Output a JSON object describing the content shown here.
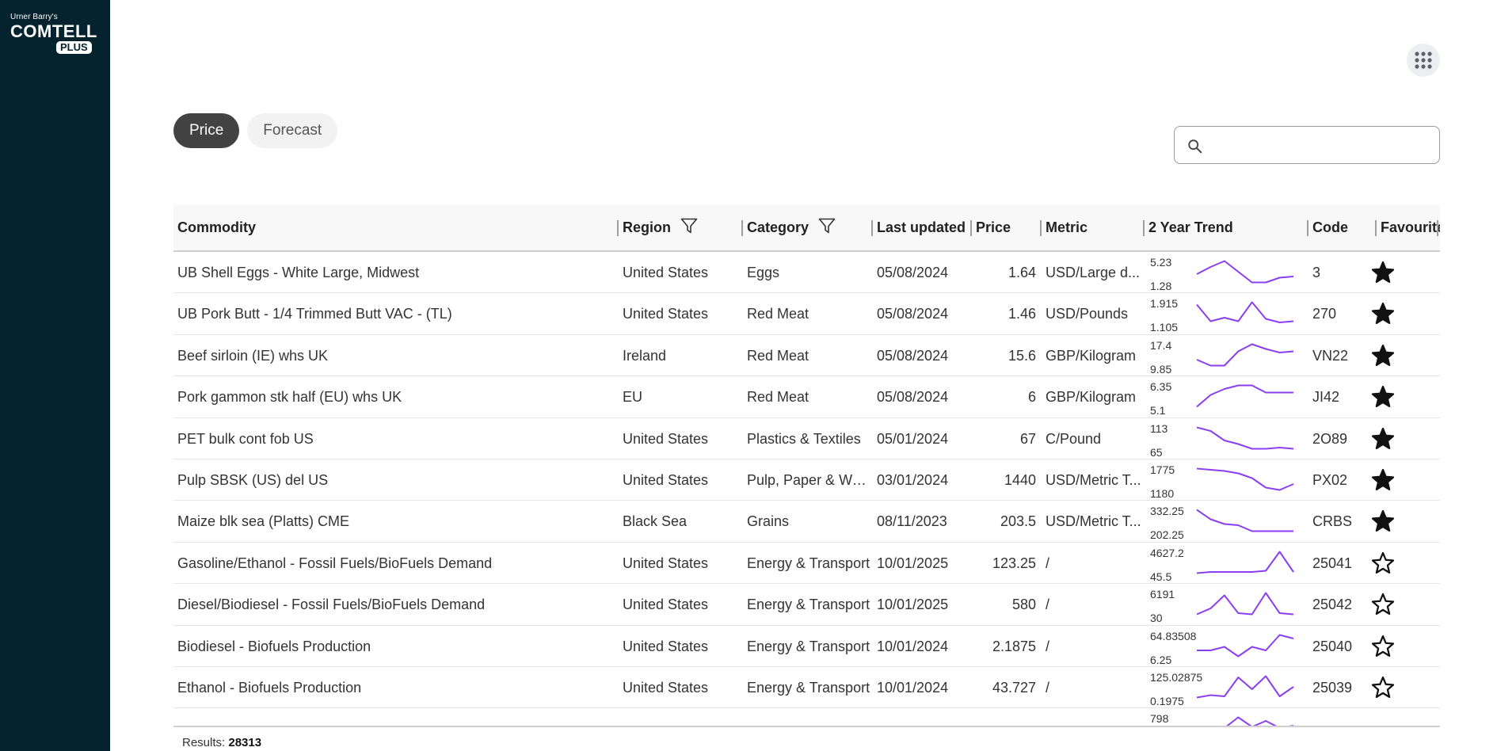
{
  "logo": {
    "top": "Urner Barry's",
    "main": "COMTELL",
    "badge": "PLUS"
  },
  "apps_icon": "apps-grid-icon",
  "tabs": [
    {
      "label": "Price",
      "active": true
    },
    {
      "label": "Forecast",
      "active": false
    }
  ],
  "search": {
    "placeholder": "",
    "value": "",
    "icon": "search-icon"
  },
  "table": {
    "columns": [
      "Commodity",
      "Region",
      "Category",
      "Last updated",
      "Price",
      "Metric",
      "2 Year Trend",
      "Code",
      "Favourite"
    ],
    "filter_columns": [
      "Region",
      "Category"
    ],
    "rows": [
      {
        "commodity": "UB Shell Eggs - White Large, Midwest",
        "region": "United States",
        "category": "Eggs",
        "last_updated": "05/08/2024",
        "price": "1.64",
        "metric": "USD/Large d...",
        "trend_max": "5.23",
        "trend_min": "1.28",
        "trend": [
          0.4,
          0.7,
          0.95,
          0.5,
          0.05,
          0.05,
          0.25,
          0.3
        ],
        "code": "3",
        "favourite": true
      },
      {
        "commodity": "UB Pork Butt - 1/4 Trimmed Butt VAC - (TL)",
        "region": "United States",
        "category": "Red Meat",
        "last_updated": "05/08/2024",
        "price": "1.46",
        "metric": "USD/Pounds",
        "trend_max": "1.915",
        "trend_min": "1.105",
        "trend": [
          0.85,
          0.15,
          0.3,
          0.15,
          0.95,
          0.25,
          0.1,
          0.15
        ],
        "code": "270",
        "favourite": true
      },
      {
        "commodity": "Beef sirloin (IE) whs UK",
        "region": "Ireland",
        "category": "Red Meat",
        "last_updated": "05/08/2024",
        "price": "15.6",
        "metric": "GBP/Kilogram",
        "trend_max": "17.4",
        "trend_min": "9.85",
        "trend": [
          0.3,
          0.05,
          0.05,
          0.65,
          0.95,
          0.75,
          0.6,
          0.65
        ],
        "code": "VN22",
        "favourite": true
      },
      {
        "commodity": "Pork gammon stk half (EU) whs UK",
        "region": "EU",
        "category": "Red Meat",
        "last_updated": "05/08/2024",
        "price": "6",
        "metric": "GBP/Kilogram",
        "trend_max": "6.35",
        "trend_min": "5.1",
        "trend": [
          0.05,
          0.55,
          0.8,
          0.95,
          0.95,
          0.65,
          0.65,
          0.65
        ],
        "code": "JI42",
        "favourite": true
      },
      {
        "commodity": "PET bulk cont fob US",
        "region": "United States",
        "category": "Plastics & Textiles",
        "last_updated": "05/01/2024",
        "price": "67",
        "metric": "C/Pound",
        "trend_max": "113",
        "trend_min": "65",
        "trend": [
          0.95,
          0.8,
          0.4,
          0.25,
          0.05,
          0.05,
          0.1,
          0.05
        ],
        "code": "2O89",
        "favourite": true
      },
      {
        "commodity": "Pulp SBSK (US) del US",
        "region": "United States",
        "category": "Pulp, Paper & Wo...",
        "last_updated": "03/01/2024",
        "price": "1440",
        "metric": "USD/Metric T...",
        "trend_max": "1775",
        "trend_min": "1180",
        "trend": [
          0.95,
          0.9,
          0.85,
          0.75,
          0.55,
          0.15,
          0.05,
          0.3
        ],
        "code": "PX02",
        "favourite": true
      },
      {
        "commodity": "Maize blk sea (Platts) CME",
        "region": "Black Sea",
        "category": "Grains",
        "last_updated": "08/11/2023",
        "price": "203.5",
        "metric": "USD/Metric T...",
        "trend_max": "332.25",
        "trend_min": "202.25",
        "trend": [
          0.95,
          0.55,
          0.35,
          0.3,
          0.05,
          0.05,
          0.05,
          0.05
        ],
        "code": "CRBS",
        "favourite": true
      },
      {
        "commodity": "Gasoline/Ethanol - Fossil Fuels/BioFuels Demand",
        "region": "United States",
        "category": "Energy & Transport",
        "last_updated": "10/01/2025",
        "price": "123.25",
        "metric": "/",
        "trend_max": "4627.2",
        "trend_min": "45.5",
        "trend": [
          0.05,
          0.1,
          0.1,
          0.1,
          0.1,
          0.15,
          0.95,
          0.1
        ],
        "code": "25041",
        "favourite": false
      },
      {
        "commodity": "Diesel/Biodiesel - Fossil Fuels/BioFuels Demand",
        "region": "United States",
        "category": "Energy & Transport",
        "last_updated": "10/01/2025",
        "price": "580",
        "metric": "/",
        "trend_max": "6191",
        "trend_min": "30",
        "trend": [
          0.05,
          0.3,
          0.85,
          0.1,
          0.05,
          0.95,
          0.1,
          0.05
        ],
        "code": "25042",
        "favourite": false
      },
      {
        "commodity": "Biodiesel - Biofuels Production",
        "region": "United States",
        "category": "Energy & Transport",
        "last_updated": "10/01/2024",
        "price": "2.1875",
        "metric": "/",
        "trend_max": "64.83508",
        "trend_min": "6.25",
        "trend": [
          0.3,
          0.3,
          0.45,
          0.05,
          0.45,
          0.3,
          0.95,
          0.8
        ],
        "code": "25040",
        "favourite": false
      },
      {
        "commodity": "Ethanol - Biofuels Production",
        "region": "United States",
        "category": "Energy & Transport",
        "last_updated": "10/01/2024",
        "price": "43.727",
        "metric": "/",
        "trend_max": "125.02875",
        "trend_min": "0.1975",
        "trend": [
          0.05,
          0.15,
          0.1,
          0.9,
          0.4,
          0.95,
          0.1,
          0.5
        ],
        "code": "25039",
        "favourite": false
      },
      {
        "commodity": "",
        "region": "",
        "category": "",
        "last_updated": "",
        "price": "",
        "metric": "",
        "trend_max": "798",
        "trend_min": "",
        "trend": [
          0.4,
          0.3,
          0.5,
          0.95,
          0.55,
          0.8,
          0.5,
          0.6
        ],
        "code": "",
        "favourite": false
      }
    ]
  },
  "results": {
    "label": "Results:",
    "count": "28313"
  },
  "colors": {
    "sidebar": "#05232e",
    "trend_line": "#8b3ff2",
    "active_tab": "#424242"
  }
}
